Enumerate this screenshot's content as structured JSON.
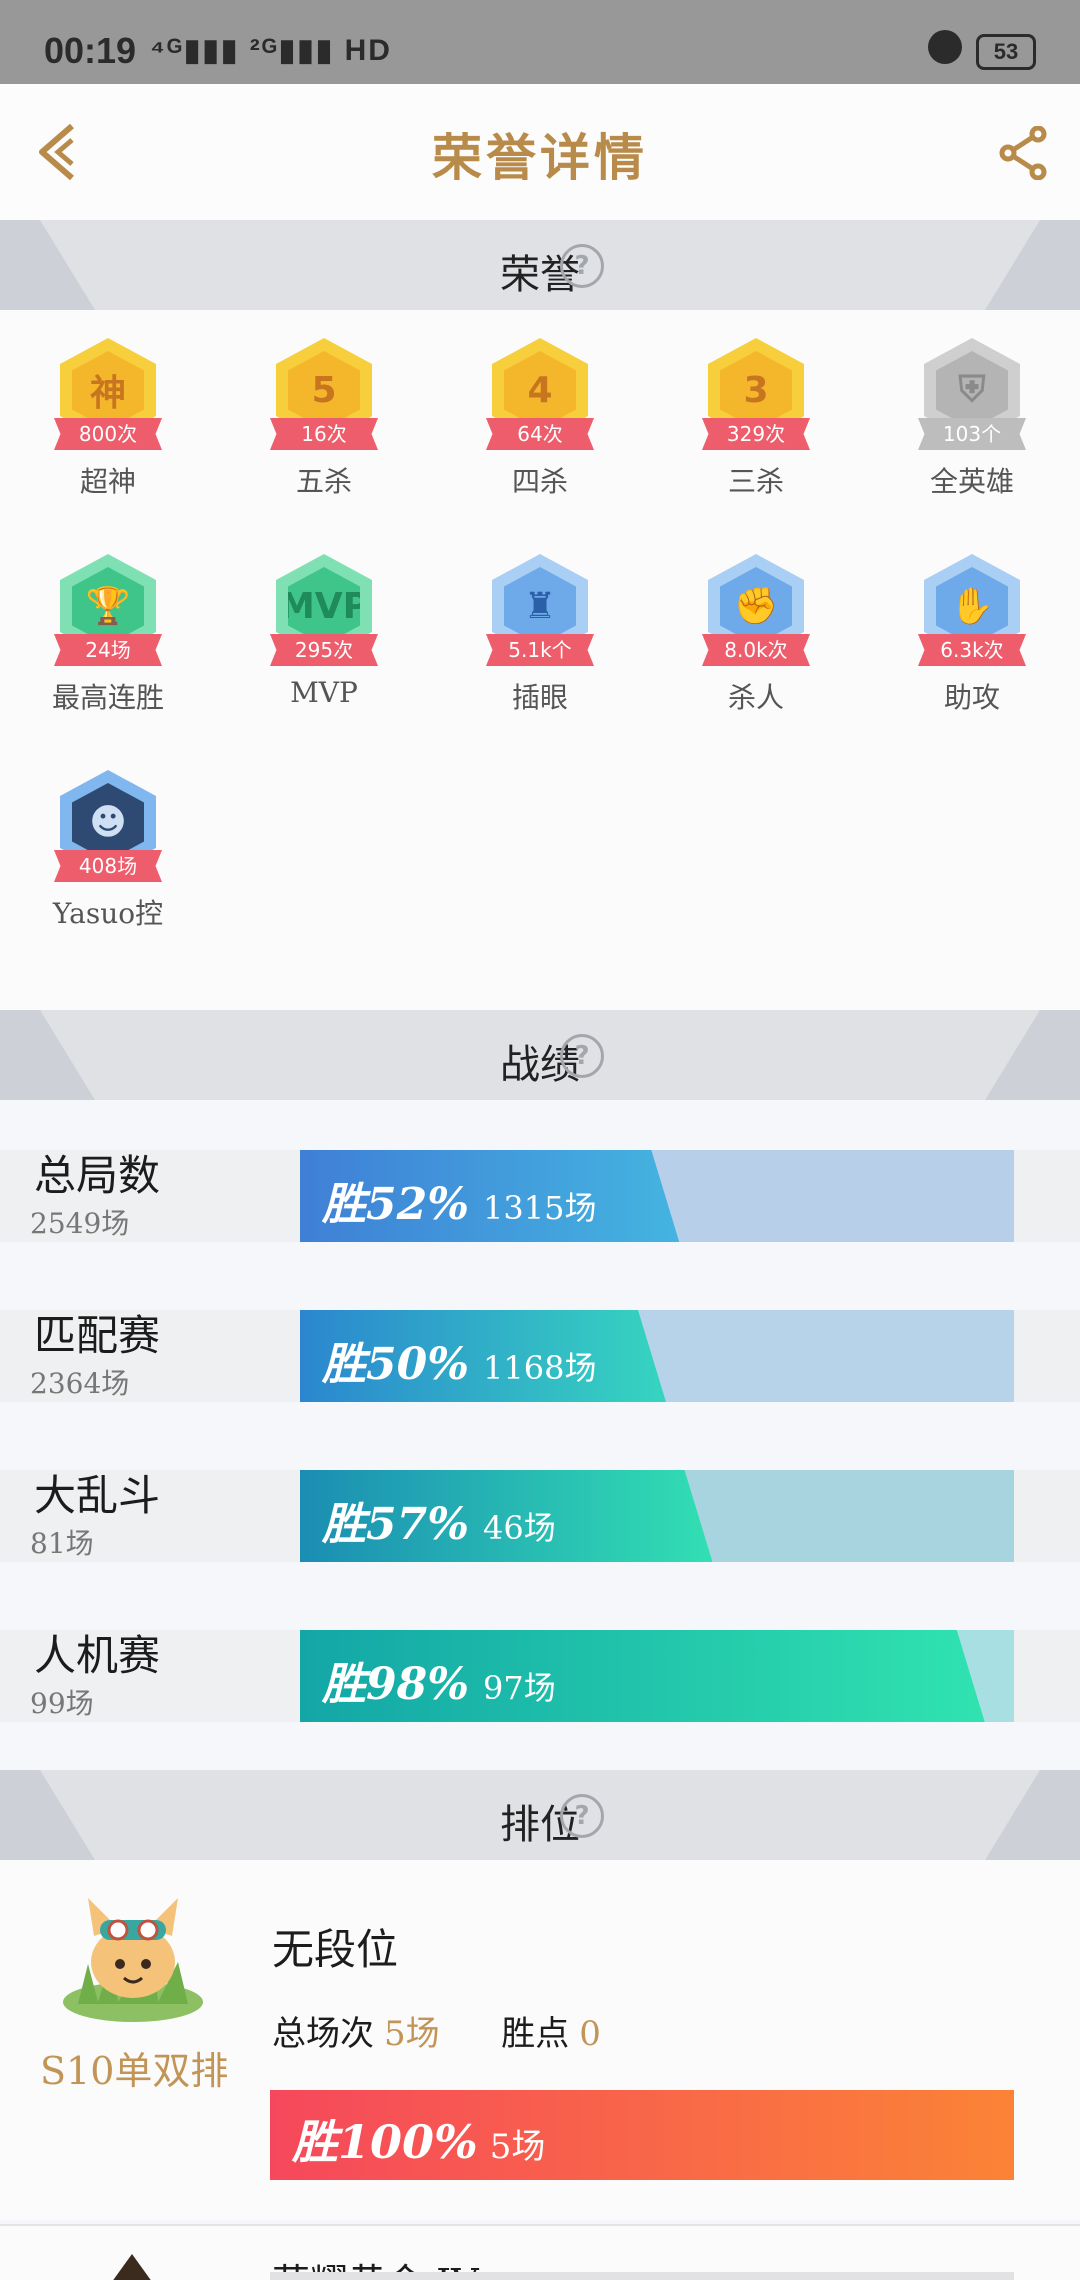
{
  "status_bar": {
    "time": "00:19",
    "network": "⁴ᴳ▮▮▮ ²ᴳ▮▮▮ HD",
    "battery": "53"
  },
  "header": {
    "title": "荣誉详情",
    "back_icon": "chevron-left-icon",
    "share_icon": "share-icon"
  },
  "sections": {
    "honors": "荣誉",
    "stats": "战绩",
    "rank": "排位",
    "help": "?"
  },
  "honors": [
    {
      "glyph": "神",
      "value": "800次",
      "name": "超神",
      "color": "gold"
    },
    {
      "glyph": "5",
      "value": "16次",
      "name": "五杀",
      "color": "gold"
    },
    {
      "glyph": "4",
      "value": "64次",
      "name": "四杀",
      "color": "gold"
    },
    {
      "glyph": "3",
      "value": "329次",
      "name": "三杀",
      "color": "gold"
    },
    {
      "glyph": "⛨",
      "value": "103个",
      "name": "全英雄",
      "color": "grey"
    },
    {
      "glyph": "🏆",
      "value": "24场",
      "name": "最高连胜",
      "color": "green"
    },
    {
      "glyph": "MVP",
      "value": "295次",
      "name": "MVP",
      "color": "green"
    },
    {
      "glyph": "♜",
      "value": "5.1k个",
      "name": "插眼",
      "color": "blue"
    },
    {
      "glyph": "✊",
      "value": "8.0k次",
      "name": "杀人",
      "color": "blue"
    },
    {
      "glyph": "✋",
      "value": "6.3k次",
      "name": "助攻",
      "color": "blue"
    },
    {
      "glyph": "☻",
      "value": "408场",
      "name": "Yasuo控",
      "color": "navy"
    }
  ],
  "stats": [
    {
      "name": "总局数",
      "count": "2549场",
      "pct": "胜52%",
      "games": "1315场",
      "win_rate": 0.52,
      "track": "#b8cfea",
      "grad": [
        "#3f7fd6",
        "#44b4e0"
      ]
    },
    {
      "name": "匹配赛",
      "count": "2364场",
      "pct": "胜50%",
      "games": "1168场",
      "win_rate": 0.5,
      "track": "#b6d3ea",
      "grad": [
        "#2b86cf",
        "#36d5c0"
      ]
    },
    {
      "name": "大乱斗",
      "count": "81场",
      "pct": "胜57%",
      "games": "46场",
      "win_rate": 0.57,
      "track": "#a8d4e0",
      "grad": [
        "#1b8db3",
        "#32dfb3"
      ]
    },
    {
      "name": "人机赛",
      "count": "99场",
      "pct": "胜98%",
      "games": "97场",
      "win_rate": 0.98,
      "track": "#a8dfe2",
      "grad": [
        "#13a6a6",
        "#30e3b0"
      ]
    }
  ],
  "rank": {
    "season": "S10单双排",
    "tier": "无段位",
    "total_label": "总场次",
    "total_value": "5场",
    "points_label": "胜点",
    "points_value": "0",
    "pct": "胜100%",
    "games": "5场",
    "next_tier": "荣耀黄金 IV"
  }
}
